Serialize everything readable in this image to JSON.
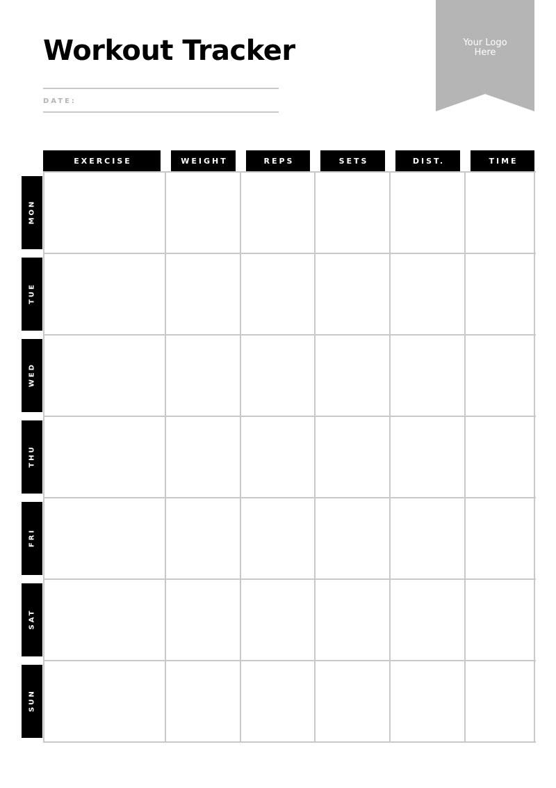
{
  "header": {
    "title": "Workout Tracker",
    "date_label": "DATE:",
    "logo_text_line1": "Your Logo",
    "logo_text_line2": "Here"
  },
  "colors": {
    "header_bg": "#000000",
    "header_text": "#ffffff",
    "grid_line": "#c8c8c8",
    "logo_bg": "#b5b5b5",
    "date_label": "#b5b5b5"
  },
  "table": {
    "columns": [
      "EXERCISE",
      "WEIGHT",
      "REPS",
      "SETS",
      "DIST.",
      "TIME"
    ],
    "days": [
      "MON",
      "TUE",
      "WED",
      "THU",
      "FRI",
      "SAT",
      "SUN"
    ],
    "cells": [
      [
        "",
        "",
        "",
        "",
        "",
        ""
      ],
      [
        "",
        "",
        "",
        "",
        "",
        ""
      ],
      [
        "",
        "",
        "",
        "",
        "",
        ""
      ],
      [
        "",
        "",
        "",
        "",
        "",
        ""
      ],
      [
        "",
        "",
        "",
        "",
        "",
        ""
      ],
      [
        "",
        "",
        "",
        "",
        "",
        ""
      ],
      [
        "",
        "",
        "",
        "",
        "",
        ""
      ]
    ]
  }
}
